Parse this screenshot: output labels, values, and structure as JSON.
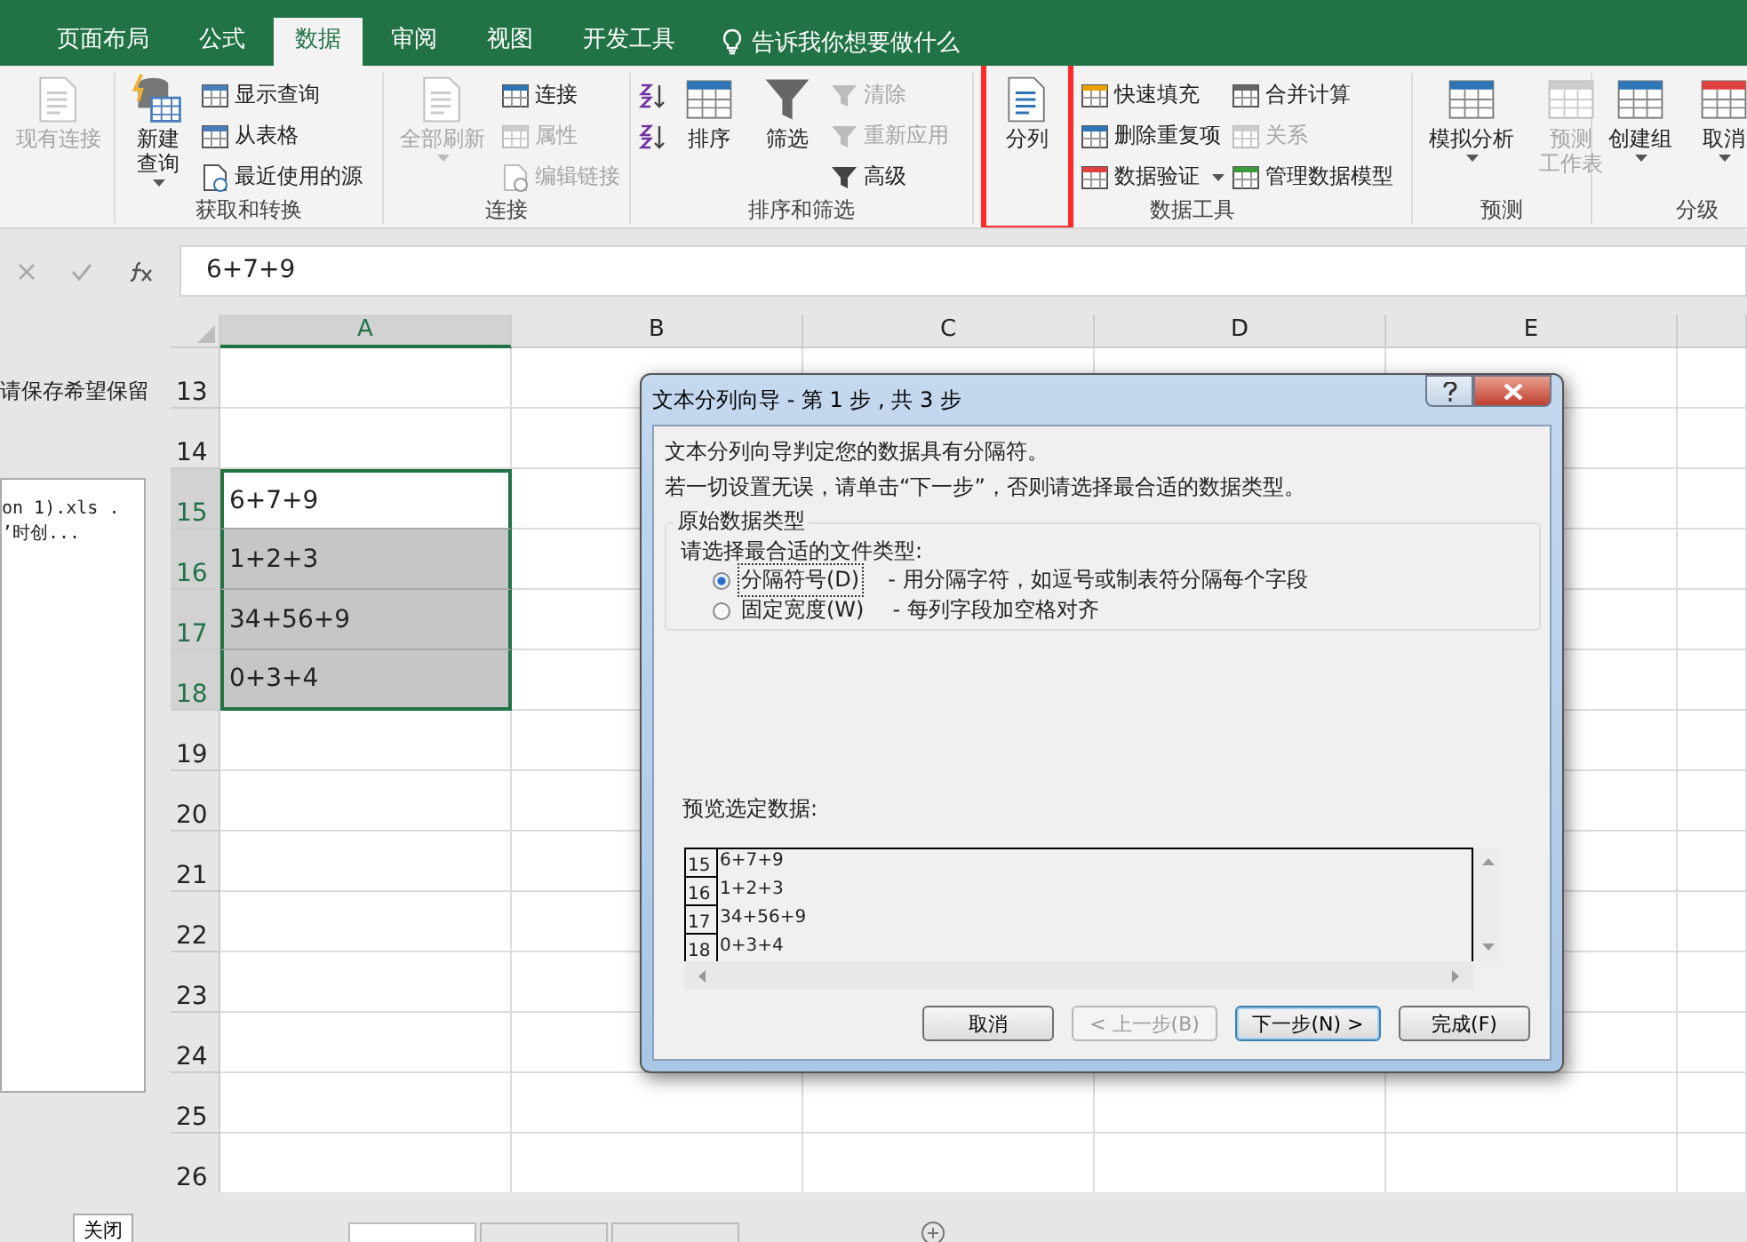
{
  "ribbon": {
    "tabs": [
      {
        "label": "页面布局",
        "selected": false
      },
      {
        "label": "公式",
        "selected": false
      },
      {
        "label": "数据",
        "selected": true
      },
      {
        "label": "审阅",
        "selected": false
      },
      {
        "label": "视图",
        "selected": false
      },
      {
        "label": "开发工具",
        "selected": false
      }
    ],
    "tell_me": "告诉我你想要做什么",
    "groups": [
      {
        "columns": [
          {
            "kind": "large",
            "items": [
              {
                "label": "现有连接",
                "disabled": true,
                "dropdown": false,
                "highlighted": false
              }
            ]
          }
        ]
      },
      {
        "label": "获取和转换",
        "columns": [
          {
            "kind": "large",
            "items": [
              {
                "label_lines": [
                  "新建",
                  "查询"
                ],
                "disabled": false,
                "dropdown": true,
                "highlighted": false
              }
            ]
          },
          {
            "kind": "stack",
            "items": [
              {
                "label": "显示查询",
                "disabled": false,
                "dropdown": false
              },
              {
                "label": "从表格",
                "disabled": false,
                "dropdown": false
              },
              {
                "label": "最近使用的源",
                "disabled": false,
                "dropdown": false
              }
            ]
          }
        ]
      },
      {
        "label": "连接",
        "columns": [
          {
            "kind": "large",
            "items": [
              {
                "label": "全部刷新",
                "disabled": true,
                "dropdown": true,
                "highlighted": false
              }
            ]
          },
          {
            "kind": "stack",
            "items": [
              {
                "label": "连接",
                "disabled": false,
                "dropdown": false
              },
              {
                "label": "属性",
                "disabled": true,
                "dropdown": false
              },
              {
                "label": "编辑链接",
                "disabled": true,
                "dropdown": false
              }
            ]
          }
        ]
      },
      {
        "label": "排序和筛选",
        "columns": [
          {
            "kind": "stack",
            "items": [
              {
                "disabled": false,
                "dropdown": false
              },
              {
                "disabled": false,
                "dropdown": false
              }
            ]
          },
          {
            "kind": "large",
            "items": [
              {
                "label": "排序",
                "disabled": false,
                "dropdown": false,
                "highlighted": false
              }
            ]
          },
          {
            "kind": "large",
            "items": [
              {
                "label": "筛选",
                "disabled": false,
                "dropdown": false,
                "highlighted": false
              }
            ]
          },
          {
            "kind": "stack",
            "items": [
              {
                "label": "清除",
                "disabled": true,
                "dropdown": false
              },
              {
                "label": "重新应用",
                "disabled": true,
                "dropdown": false
              },
              {
                "label": "高级",
                "disabled": false,
                "dropdown": false
              }
            ]
          }
        ]
      },
      {
        "label": "数据工具",
        "columns": [
          {
            "kind": "large",
            "items": [
              {
                "label": "分列",
                "disabled": false,
                "dropdown": false,
                "highlighted": true
              }
            ]
          },
          {
            "kind": "stack",
            "items": [
              {
                "label": "快速填充",
                "disabled": false,
                "dropdown": false
              },
              {
                "label": "删除重复项",
                "disabled": false,
                "dropdown": false
              },
              {
                "label": "数据验证",
                "disabled": false,
                "dropdown": true
              }
            ]
          },
          {
            "kind": "stack",
            "items": [
              {
                "label": "合并计算",
                "disabled": false,
                "dropdown": false
              },
              {
                "label": "关系",
                "disabled": true,
                "dropdown": false
              },
              {
                "label": "管理数据模型",
                "disabled": false,
                "dropdown": false
              }
            ]
          }
        ]
      },
      {
        "label": "预测",
        "columns": [
          {
            "kind": "large",
            "items": [
              {
                "label": "模拟分析",
                "disabled": false,
                "dropdown": true,
                "highlighted": false
              }
            ]
          },
          {
            "kind": "large",
            "items": [
              {
                "label_lines": [
                  "预测",
                  "工作表"
                ],
                "disabled": true,
                "dropdown": false,
                "highlighted": false
              }
            ]
          }
        ]
      },
      {
        "label": "分级",
        "columns": [
          {
            "kind": "large",
            "items": [
              {
                "label": "创建组",
                "disabled": false,
                "dropdown": true,
                "highlighted": false
              }
            ]
          },
          {
            "kind": "large",
            "items": [
              {
                "label": "取消",
                "disabled": false,
                "dropdown": true,
                "highlighted": false
              }
            ]
          }
        ]
      }
    ]
  },
  "formula_bar": {
    "value": "6+7+9"
  },
  "side_pane": {
    "message": "请保存希望保留",
    "list_lines": [
      "on 1).xls .",
      "’时创..."
    ],
    "close_button": "关闭"
  },
  "sheet": {
    "columns": [
      {
        "label": "A",
        "selected": true
      },
      {
        "label": "B",
        "selected": false
      },
      {
        "label": "C",
        "selected": false
      },
      {
        "label": "D",
        "selected": false
      },
      {
        "label": "E",
        "selected": false
      }
    ],
    "rows": [
      {
        "number": "13",
        "selected": false,
        "active": false
      },
      {
        "number": "14",
        "selected": false,
        "active": false
      },
      {
        "number": "15",
        "value": "6+7+9",
        "selected": true,
        "active": true
      },
      {
        "number": "16",
        "value": "1+2+3",
        "selected": true,
        "active": false
      },
      {
        "number": "17",
        "value": "34+56+9",
        "selected": true,
        "active": false
      },
      {
        "number": "18",
        "value": "0+3+4",
        "selected": true,
        "active": false
      },
      {
        "number": "19",
        "selected": false,
        "active": false
      },
      {
        "number": "20",
        "selected": false,
        "active": false
      },
      {
        "number": "21",
        "selected": false,
        "active": false
      },
      {
        "number": "22",
        "selected": false,
        "active": false
      },
      {
        "number": "23",
        "selected": false,
        "active": false
      },
      {
        "number": "24",
        "selected": false,
        "active": false
      },
      {
        "number": "25",
        "selected": false,
        "active": false
      },
      {
        "number": "26",
        "selected": false,
        "active": false
      }
    ],
    "sheet_tabs": [
      {
        "selected": true
      },
      {
        "selected": false
      },
      {
        "selected": false
      }
    ]
  },
  "dialog": {
    "title": "文本分列向导 - 第 1 步 , 共 3 步",
    "intro": [
      "文本分列向导判定您的数据具有分隔符。",
      "若一切设置无误，请单击“下一步”，否则请选择最合适的数据类型。"
    ],
    "group_title": "原始数据类型",
    "prompt": "请选择最合适的文件类型:",
    "options": [
      {
        "label": "分隔符号(D)",
        "description": "- 用分隔字符，如逗号或制表符分隔每个字段",
        "selected": true
      },
      {
        "label": "固定宽度(W)",
        "description": "- 每列字段加空格对齐",
        "selected": false
      }
    ],
    "preview_label": "预览选定数据:",
    "preview_rows": [
      {
        "number": "15",
        "value": "6+7+9"
      },
      {
        "number": "16",
        "value": "1+2+3"
      },
      {
        "number": "17",
        "value": "34+56+9"
      },
      {
        "number": "18",
        "value": "0+3+4"
      }
    ],
    "buttons": [
      {
        "label": "取消",
        "disabled": false,
        "default": false
      },
      {
        "label": "< 上一步(B)",
        "disabled": true,
        "default": false
      },
      {
        "label": "下一步(N) >",
        "disabled": false,
        "default": true
      },
      {
        "label": "完成(F)",
        "disabled": false,
        "default": false
      }
    ]
  }
}
